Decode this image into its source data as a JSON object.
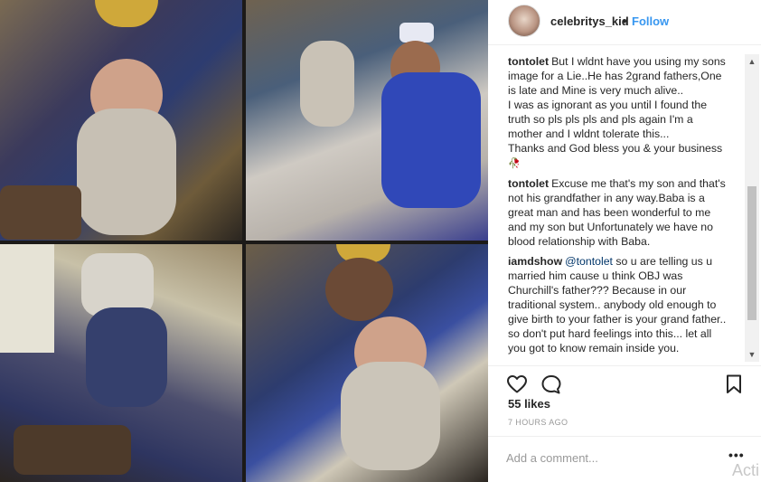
{
  "post": {
    "username": "celebritys_kid",
    "separator": "•",
    "follow_label": "Follow"
  },
  "comments": [
    {
      "author": "tontolet",
      "lines": [
        "But I wldnt have you using my sons image for a Lie..He has 2grand fathers,One is late and Mine is very much alive..",
        "I was as ignorant as you until I found the truth so pls pls pls and pls again I'm a mother and I wldnt tolerate this...",
        "Thanks and God bless you & your business"
      ],
      "emoji": "🥀"
    },
    {
      "author": "tontolet",
      "text": "Excuse me that's my son and that's not his grandfather in any way.Baba is a great man and has been wonderful to me and my son but Unfortunately we have no blood relationship with Baba."
    },
    {
      "author": "iamdshow",
      "mention": "@tontolet",
      "text": "so u are telling us u married him cause u think OBJ was Churchill's father??? Because in our traditional system.. anybody old enough to give birth to your father is your grand father.. so don't put hard feelings into this... let all you got to know remain inside you."
    }
  ],
  "scrollbar": {
    "up_arrow": "▲",
    "down_arrow": "▼"
  },
  "engagement": {
    "likes": "55 likes",
    "timestamp": "7 HOURS AGO"
  },
  "composer": {
    "placeholder": "Add a comment...",
    "more_label": "•••"
  },
  "overlay": {
    "watermark": "Acti"
  },
  "icons": {
    "like": "heart-icon",
    "comment": "comment-icon",
    "save": "bookmark-icon",
    "more": "more-icon"
  },
  "colors": {
    "link": "#3897f0",
    "text": "#262626",
    "muted": "#999999"
  }
}
